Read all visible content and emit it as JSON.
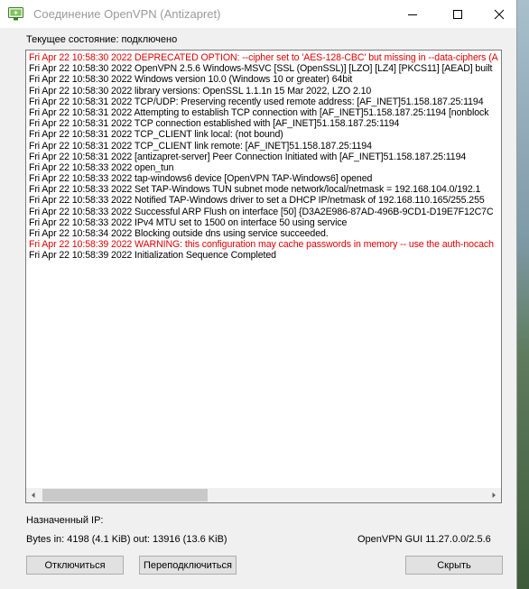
{
  "window": {
    "title": "Соединение OpenVPN (Antizapret)"
  },
  "status": {
    "text": "Текущее состояние: подключено"
  },
  "log": {
    "lines": [
      {
        "text": "Fri Apr 22 10:58:30 2022 DEPRECATED OPTION: --cipher set to 'AES-128-CBC' but missing in --data-ciphers (A",
        "level": "warning"
      },
      {
        "text": "Fri Apr 22 10:58:30 2022 OpenVPN 2.5.6 Windows-MSVC [SSL (OpenSSL)] [LZO] [LZ4] [PKCS11] [AEAD] built",
        "level": "info"
      },
      {
        "text": "Fri Apr 22 10:58:30 2022 Windows version 10.0 (Windows 10 or greater) 64bit",
        "level": "info"
      },
      {
        "text": "Fri Apr 22 10:58:30 2022 library versions: OpenSSL 1.1.1n  15 Mar 2022, LZO 2.10",
        "level": "info"
      },
      {
        "text": "Fri Apr 22 10:58:31 2022 TCP/UDP: Preserving recently used remote address: [AF_INET]51.158.187.25:1194",
        "level": "info"
      },
      {
        "text": "Fri Apr 22 10:58:31 2022 Attempting to establish TCP connection with [AF_INET]51.158.187.25:1194 [nonblock",
        "level": "info"
      },
      {
        "text": "Fri Apr 22 10:58:31 2022 TCP connection established with [AF_INET]51.158.187.25:1194",
        "level": "info"
      },
      {
        "text": "Fri Apr 22 10:58:31 2022 TCP_CLIENT link local: (not bound)",
        "level": "info"
      },
      {
        "text": "Fri Apr 22 10:58:31 2022 TCP_CLIENT link remote: [AF_INET]51.158.187.25:1194",
        "level": "info"
      },
      {
        "text": "Fri Apr 22 10:58:31 2022 [antizapret-server] Peer Connection Initiated with [AF_INET]51.158.187.25:1194",
        "level": "info"
      },
      {
        "text": "Fri Apr 22 10:58:33 2022 open_tun",
        "level": "info"
      },
      {
        "text": "Fri Apr 22 10:58:33 2022 tap-windows6 device [OpenVPN TAP-Windows6] opened",
        "level": "info"
      },
      {
        "text": "Fri Apr 22 10:58:33 2022 Set TAP-Windows TUN subnet mode network/local/netmask = 192.168.104.0/192.1",
        "level": "info"
      },
      {
        "text": "Fri Apr 22 10:58:33 2022 Notified TAP-Windows driver to set a DHCP IP/netmask of 192.168.110.165/255.255",
        "level": "info"
      },
      {
        "text": "Fri Apr 22 10:58:33 2022 Successful ARP Flush on interface [50] {D3A2E986-87AD-496B-9CD1-D19E7F12C7C",
        "level": "info"
      },
      {
        "text": "Fri Apr 22 10:58:33 2022 IPv4 MTU set to 1500 on interface 50 using service",
        "level": "info"
      },
      {
        "text": "Fri Apr 22 10:58:34 2022 Blocking outside dns using service succeeded.",
        "level": "info"
      },
      {
        "text": "Fri Apr 22 10:58:39 2022 WARNING: this configuration may cache passwords in memory -- use the auth-nocach",
        "level": "warning"
      },
      {
        "text": "Fri Apr 22 10:58:39 2022 Initialization Sequence Completed",
        "level": "info"
      }
    ]
  },
  "info": {
    "assigned_ip_label": "Назначенный IP:",
    "bytes_text": "Bytes in: 4198 (4.1 KiB)  out: 13916 (13.6 KiB)",
    "version_text": "OpenVPN GUI 11.27.0.0/2.5.6"
  },
  "buttons": {
    "disconnect": "Отключиться",
    "reconnect": "Переподключиться",
    "hide": "Скрыть"
  },
  "colors": {
    "warning_text": "#e00000",
    "info_text": "#000000",
    "title_text": "#9a9a9a"
  }
}
